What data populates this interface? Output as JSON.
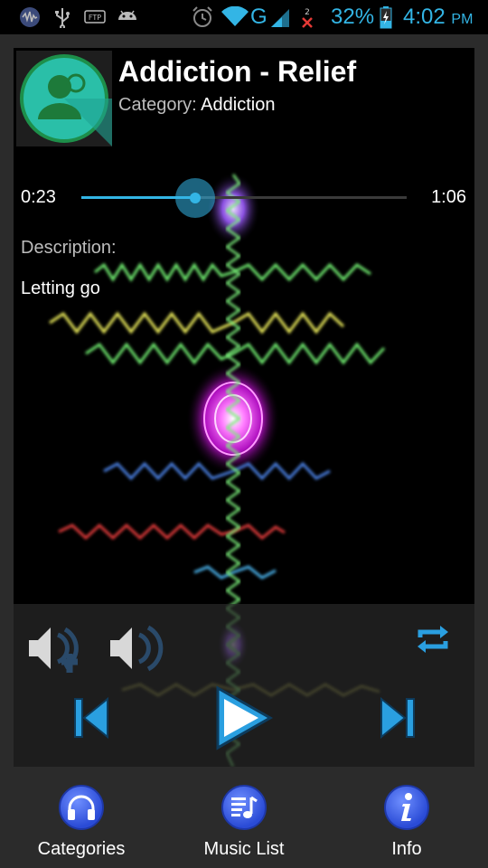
{
  "status_bar": {
    "battery": "32%",
    "time": "4:02",
    "ampm": "PM",
    "network": "G",
    "sim_slot": "2",
    "icons": [
      "app-activity-icon",
      "usb-icon",
      "ftp-icon",
      "android-icon",
      "alarm-icon",
      "wifi-icon",
      "signal-icon",
      "no-signal-icon",
      "battery-charging-icon"
    ]
  },
  "track": {
    "title": "Addiction - Relief",
    "category_label": "Category:",
    "category_value": "Addiction",
    "thumbnail_icon": "user-group-icon"
  },
  "player": {
    "current_time": "0:23",
    "total_time": "1:06",
    "progress": 0.35,
    "accent_color": "#33b5e5"
  },
  "description": {
    "label": "Description:",
    "text": "Letting go"
  },
  "controls": {
    "icons": [
      "volume-down-icon",
      "volume-up-icon",
      "repeat-icon",
      "previous-icon",
      "play-icon",
      "next-icon"
    ]
  },
  "bottom_nav": {
    "items": [
      {
        "label": "Categories",
        "icon": "headphones-icon"
      },
      {
        "label": "Music List",
        "icon": "music-list-icon"
      },
      {
        "label": "Info",
        "icon": "info-icon"
      }
    ]
  }
}
